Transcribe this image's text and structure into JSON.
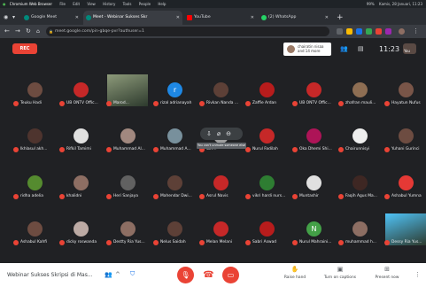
{
  "os_bar": {
    "app_name": "Chromium Web Browser",
    "menu": [
      "File",
      "Edit",
      "View",
      "History",
      "Tools",
      "People",
      "Help"
    ],
    "status": "99%",
    "datetime": "Kamis, 28 Januari, 11:23"
  },
  "tabs": [
    {
      "label": "Google Meet",
      "favicon_color": "#00897b",
      "active": false
    },
    {
      "label": "Meet - Webinar Sukses Skr",
      "favicon_color": "#00897b",
      "active": true
    },
    {
      "label": "YouTube",
      "favicon_color": "#ff0000",
      "active": false
    },
    {
      "label": "(2) WhatsApp",
      "favicon_color": "#25d366",
      "active": false
    }
  ],
  "address_bar": {
    "url": "meet.google.com/pin-gbqe-pvr?authuser=1"
  },
  "meet_header": {
    "rec_label": "REC",
    "presenter_line1": "chairatin nisaa",
    "presenter_line2": "and 14 more",
    "clock": "11:23",
    "self_label": "You"
  },
  "participants": [
    {
      "name": "Teuku Hadi",
      "avatar_color": "#6d4c41",
      "initial": ""
    },
    {
      "name": "UB ONTV Offic...",
      "avatar_color": "#c62828",
      "initial": ""
    },
    {
      "name": "Marod...",
      "avatar_color": "#8d9a7a",
      "initial": "",
      "video": true
    },
    {
      "name": "rizal adrianayah",
      "avatar_color": "#1e88e5",
      "initial": "r"
    },
    {
      "name": "Rivkan Nanda ...",
      "avatar_color": "#5d4037",
      "initial": ""
    },
    {
      "name": "Zaffie Ardan",
      "avatar_color": "#b71c1c",
      "initial": ""
    },
    {
      "name": "UB ONTV Offic...",
      "avatar_color": "#c62828",
      "initial": ""
    },
    {
      "name": "zhafran mauli...",
      "avatar_color": "#8e6e53",
      "initial": ""
    },
    {
      "name": "Hayatun Nufus",
      "avatar_color": "#795548",
      "initial": ""
    },
    {
      "name": "Ikhlasul akh...",
      "avatar_color": "#4e342e",
      "initial": ""
    },
    {
      "name": "Rifkil Tamimi",
      "avatar_color": "#e0e0e0",
      "initial": ""
    },
    {
      "name": "Muhammad Al...",
      "avatar_color": "#a1887f",
      "initial": ""
    },
    {
      "name": "Muhammad A...",
      "avatar_color": "#78909c",
      "initial": ""
    },
    {
      "name": "Ciri...",
      "avatar_color": "#9e9e9e",
      "initial": ""
    },
    {
      "name": "Nurul Fadilah",
      "avatar_color": "#c62828",
      "initial": ""
    },
    {
      "name": "Oka Dhemi Shi...",
      "avatar_color": "#ad1457",
      "initial": ""
    },
    {
      "name": "Chairunnisyi",
      "avatar_color": "#eeeeee",
      "initial": ""
    },
    {
      "name": "Yuhani Gurinci",
      "avatar_color": "#6d4c41",
      "initial": ""
    },
    {
      "name": "ridha adelia",
      "avatar_color": "#558b2f",
      "initial": ""
    },
    {
      "name": "khalidni",
      "avatar_color": "#8d6e63",
      "initial": ""
    },
    {
      "name": "Heri Sanjaya",
      "avatar_color": "#616161",
      "initial": ""
    },
    {
      "name": "Mahendar Dwi...",
      "avatar_color": "#5d4037",
      "initial": ""
    },
    {
      "name": "Asrul Navis",
      "avatar_color": "#c62828",
      "initial": ""
    },
    {
      "name": "vikri hardi nurs...",
      "avatar_color": "#2e7d32",
      "initial": ""
    },
    {
      "name": "Muntashir",
      "avatar_color": "#e0e0e0",
      "initial": ""
    },
    {
      "name": "Faqih Agus Ma...",
      "avatar_color": "#3e2723",
      "initial": ""
    },
    {
      "name": "Ashabul Yumna",
      "avatar_color": "#e53935",
      "initial": ""
    },
    {
      "name": "Ashabul Kahfi",
      "avatar_color": "#6d4c41",
      "initial": ""
    },
    {
      "name": "dicky roswanda",
      "avatar_color": "#bcaaa4",
      "initial": ""
    },
    {
      "name": "Destty Ria Yus...",
      "avatar_color": "#8d6e63",
      "initial": ""
    },
    {
      "name": "Nelus Saidah",
      "avatar_color": "#5d4037",
      "initial": ""
    },
    {
      "name": "Melan Melani",
      "avatar_color": "#c62828",
      "initial": ""
    },
    {
      "name": "Sabri Aswad",
      "avatar_color": "#b71c1c",
      "initial": ""
    },
    {
      "name": "Nurul Mahraini...",
      "avatar_color": "#43a047",
      "initial": "N"
    },
    {
      "name": "muhammad h...",
      "avatar_color": "#8d6e63",
      "initial": ""
    },
    {
      "name": "Dessy Ria Yus...",
      "avatar_color": "#4fc3f7",
      "initial": "",
      "video": true
    }
  ],
  "hover_tooltip": "You can't unmute someone else",
  "bottom_bar": {
    "meeting_name": "Webinar Sukses Skripsi di Mas...",
    "raise_hand": "Raise hand",
    "captions": "Turn on captions",
    "present": "Present now"
  },
  "colors": {
    "meet_bg": "#202124",
    "muted_red": "#ea4335",
    "tile_bg": "#202124"
  }
}
